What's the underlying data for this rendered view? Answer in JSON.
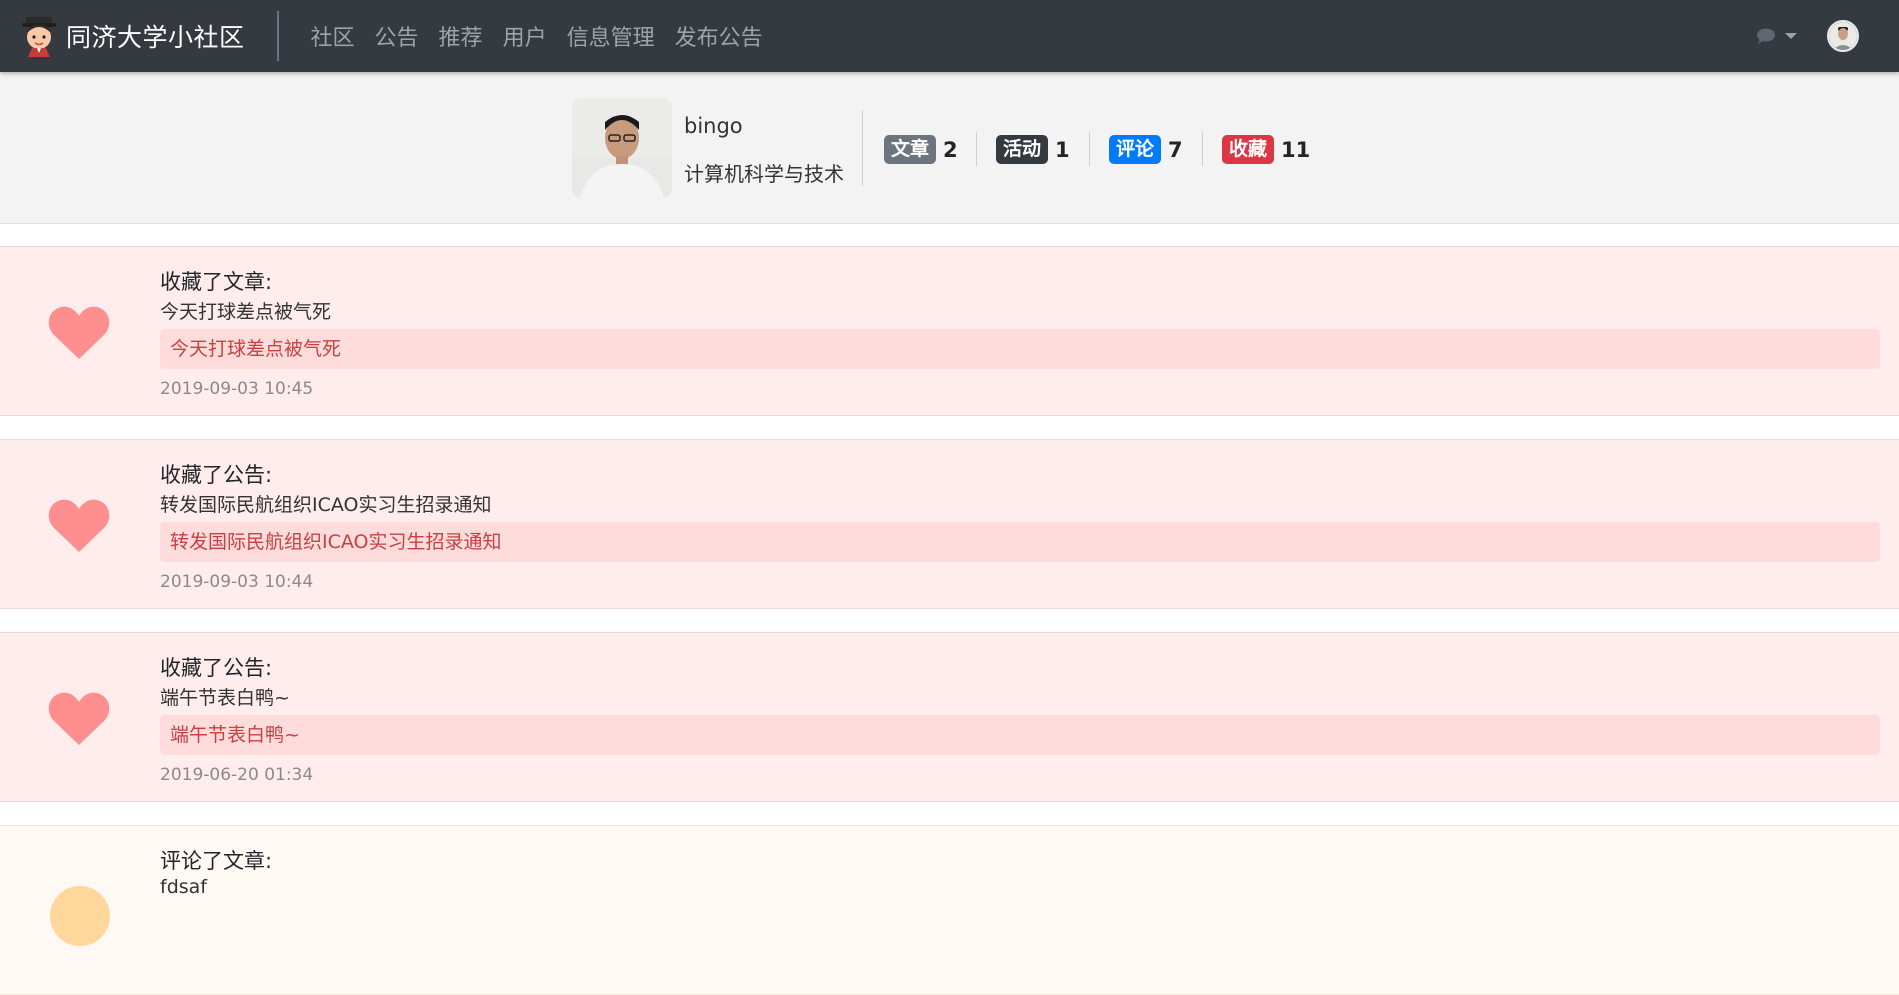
{
  "navbar": {
    "brand": "同济大学小社区",
    "links": [
      "社区",
      "公告",
      "推荐",
      "用户",
      "信息管理",
      "发布公告"
    ],
    "message_icon": "chat-bubble-icon"
  },
  "profile": {
    "name": "bingo",
    "major": "计算机科学与技术",
    "stats": [
      {
        "label": "文章",
        "count": "2",
        "color": "#6c757d"
      },
      {
        "label": "活动",
        "count": "1",
        "color": "#343a40"
      },
      {
        "label": "评论",
        "count": "7",
        "color": "#007bff"
      },
      {
        "label": "收藏",
        "count": "11",
        "color": "#dc3545"
      }
    ]
  },
  "feed": [
    {
      "action": "收藏了文章:",
      "title": "今天打球差点被气死",
      "box": "今天打球差点被气死",
      "time": "2019-09-03 10:45",
      "icon": "heart-icon"
    },
    {
      "action": "收藏了公告:",
      "title": "转发国际民航组织ICAO实习生招录通知",
      "box": "转发国际民航组织ICAO实习生招录通知",
      "time": "2019-09-03 10:44",
      "icon": "heart-icon"
    },
    {
      "action": "收藏了公告:",
      "title": "端午节表白鸭~",
      "box": "端午节表白鸭~",
      "time": "2019-06-20 01:34",
      "icon": "heart-icon"
    },
    {
      "action": "评论了文章:",
      "title": "fdsaf",
      "icon": "comment-icon"
    }
  ],
  "colors": {
    "navbar_bg": "#343a40",
    "heart": "#ff8f8f",
    "favorite_bg": "#ffeded",
    "favorite_box": "#ffdcdc",
    "comment_bg": "#fff8f3"
  }
}
